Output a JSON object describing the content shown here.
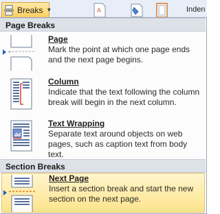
{
  "ribbon": {
    "breaks_label": "Breaks",
    "side_text": "Inden"
  },
  "menu": {
    "page_breaks_header": "Page Breaks",
    "section_breaks_header": "Section Breaks",
    "items": [
      {
        "title": "Page",
        "description": "Mark the point at which one page ends and the next page begins."
      },
      {
        "title": "Column",
        "description": "Indicate that the text following the column break will begin in the next column."
      },
      {
        "title": "Text Wrapping",
        "description": "Separate text around objects on web pages, such as caption text from body text."
      },
      {
        "title": "Next Page",
        "description": "Insert a section break and start the new section on the next page."
      }
    ]
  },
  "colors": {
    "highlight": "#fde48c",
    "header_bg": "#dde1e8",
    "accent_blue": "#1f5fbf",
    "accent_orange": "#e07b1f"
  }
}
